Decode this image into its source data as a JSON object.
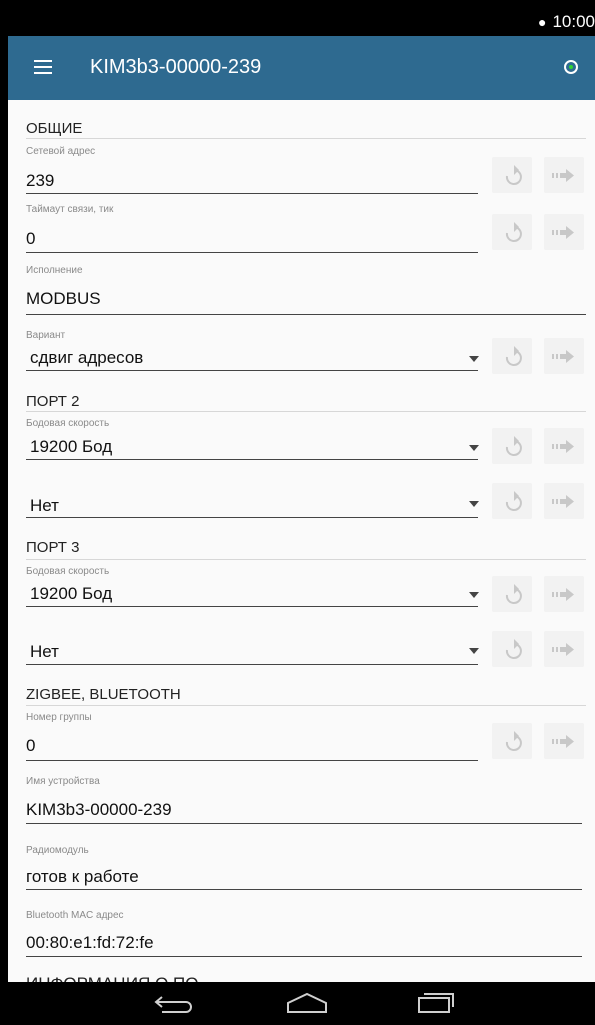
{
  "status_bar": {
    "time": "10:00"
  },
  "app_bar": {
    "title": "KIM3b3-00000-239"
  },
  "sections": {
    "general": "ОБЩИЕ",
    "port2": "ПОРТ 2",
    "port3": "ПОРТ 3",
    "zigbee": "ZIGBEE, BLUETOOTH",
    "cut_off": "ИНФОРМАЦИЯ О ПО"
  },
  "fields": {
    "net_address": {
      "label": "Сетевой адрес",
      "value": "239"
    },
    "timeout": {
      "label": "Таймаут связи, тик",
      "value": "0"
    },
    "execution": {
      "label": "Исполнение",
      "value": "MODBUS"
    },
    "variant": {
      "label": "Вариант",
      "value": "сдвиг адресов"
    },
    "port2_baud": {
      "label": "Бодовая скорость",
      "value": "19200 Бод"
    },
    "port2_mode": {
      "value": "Нет"
    },
    "port3_baud": {
      "label": "Бодовая скорость",
      "value": "19200 Бод"
    },
    "port3_mode": {
      "value": "Нет"
    },
    "group_number": {
      "label": "Номер группы",
      "value": "0"
    },
    "device_name": {
      "label": "Имя устройства",
      "value": "KIM3b3-00000-239"
    },
    "radio_module": {
      "label": "Радиомодуль",
      "value": "готов к работе"
    },
    "bt_mac": {
      "label": "Bluetooth MAC адрес",
      "value": "00:80:e1:fd:72:fe"
    }
  },
  "icons": {
    "menu": "hamburger-menu-icon",
    "connection": "connection-status-icon",
    "reset": "undo-icon",
    "send": "arrow-right-icon",
    "dropdown": "triangle-down-icon",
    "back": "back-icon",
    "home": "home-icon",
    "recents": "recents-icon"
  },
  "colors": {
    "app_bar": "#2e6a90",
    "status_dot": "#32d432",
    "background": "#fafafa"
  }
}
